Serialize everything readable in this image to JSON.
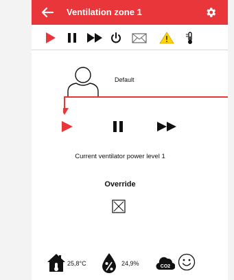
{
  "app": {
    "title": "Ventilation zone 1",
    "accent_color": "#e8363b"
  },
  "toolbar": {
    "icons": [
      "play-icon",
      "pause-icon",
      "fast-forward-icon",
      "power-icon",
      "mail-icon",
      "warning-icon",
      "thermometer-icon"
    ]
  },
  "profile": {
    "label": "Default"
  },
  "controls": {
    "icons": [
      "play-icon",
      "pause-icon",
      "fast-forward-icon"
    ]
  },
  "status": {
    "power_text": "Current ventilator power level 1"
  },
  "override": {
    "label": "Override"
  },
  "sensors": {
    "temperature": "25,8°C",
    "humidity": "24,9%",
    "co2_label": "CO2"
  }
}
